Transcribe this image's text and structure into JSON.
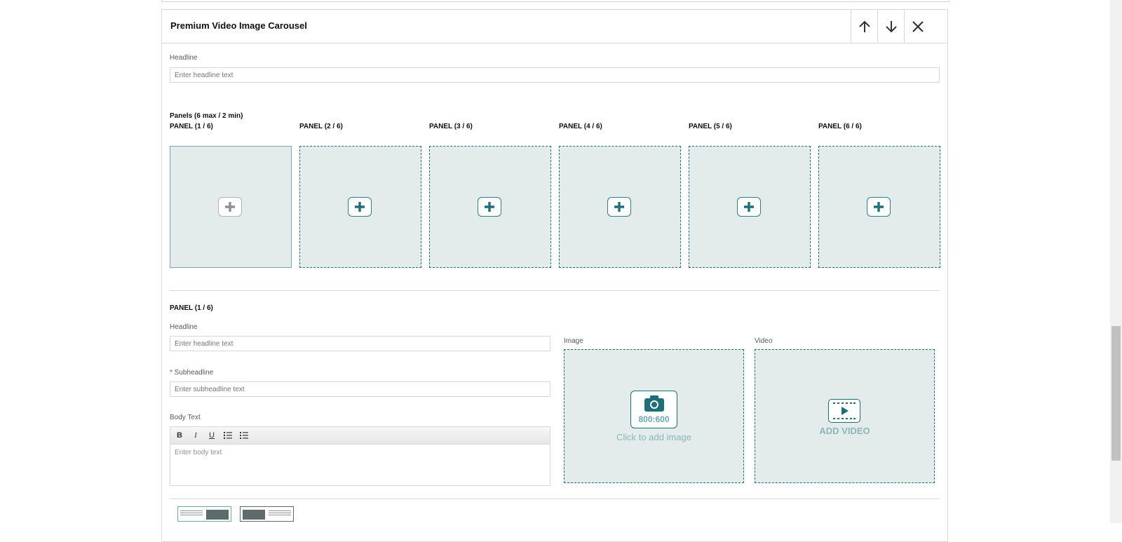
{
  "module": {
    "title": "Premium Video Image Carousel",
    "buttons": {
      "move_up": "arrow-up-icon",
      "move_down": "arrow-down-icon",
      "remove": "close-icon"
    },
    "headline": {
      "label": "Headline",
      "placeholder": "Enter headline text",
      "value": ""
    },
    "panels_heading": "Panels (6 max / 2 min)",
    "panels": [
      {
        "label": "PANEL (1 / 6)",
        "selected": true
      },
      {
        "label": "PANEL (2 / 6)",
        "selected": false
      },
      {
        "label": "PANEL (3 / 6)",
        "selected": false
      },
      {
        "label": "PANEL (4 / 6)",
        "selected": false
      },
      {
        "label": "PANEL (5 / 6)",
        "selected": false
      },
      {
        "label": "PANEL (6 / 6)",
        "selected": false
      }
    ],
    "editor": {
      "panel_title": "PANEL (1 / 6)",
      "headline_label": "Headline",
      "headline_placeholder": "Enter headline text",
      "subheadline_label": "* Subheadline",
      "subheadline_placeholder": "Enter subheadline text",
      "body_label": "Body Text",
      "body_placeholder": "Enter body text",
      "toolbar": {
        "bold": "B",
        "italic": "I",
        "underline": "U"
      },
      "image_label": "Image",
      "image_ratio": "800:600",
      "image_cta": "Click to add image",
      "video_label": "Video",
      "video_cta": "ADD VIDEO"
    }
  },
  "colors": {
    "accent": "#1f6f7a",
    "tile_bg": "#e3ebeb",
    "border": "#d5d9d9",
    "muted_text": "#8ab7bd"
  }
}
